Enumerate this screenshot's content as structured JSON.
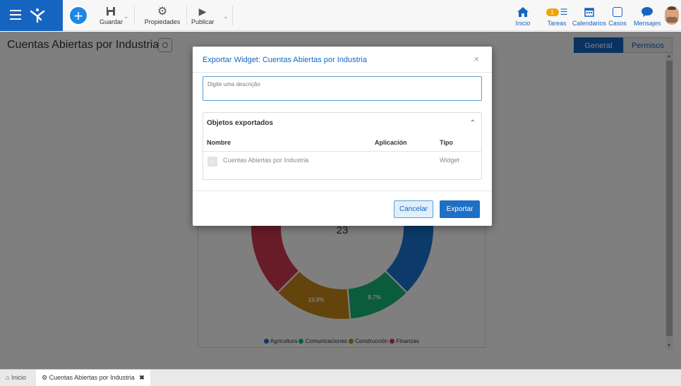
{
  "toolbar": {
    "save_label": "Guardar",
    "properties_label": "Propiedades",
    "publish_label": "Publicar"
  },
  "nav": {
    "home": "Inicio",
    "tasks": "Tareas",
    "tasks_badge": "1",
    "calendars": "Calendarios",
    "cases": "Casos",
    "messages": "Mensajes"
  },
  "page": {
    "title": "Cuentas Abiertas por Industria",
    "tab_general": "General",
    "tab_permissions": "Permisos"
  },
  "chart_data": {
    "type": "pie",
    "center_value": "23",
    "categories": [
      "Agricultura",
      "Comunicaciones",
      "Construcción",
      "Finanzas"
    ],
    "data_labels": [
      "",
      "8.7%",
      "13.0%",
      ""
    ],
    "colors": [
      "#1976d2",
      "#17b978",
      "#c8891a",
      "#d0384f"
    ]
  },
  "modal": {
    "title": "Exportar Widget: Cuentas Abiertas por Industria",
    "description_placeholder": "Digite uma descrição",
    "panel_title": "Objetos exportados",
    "col_name": "Nombre",
    "col_application": "Aplicación",
    "col_type": "Tipo",
    "row_name": "Cuentas Abiertas por Industria",
    "row_application": "",
    "row_type": "Widget",
    "cancel_label": "Cancelar",
    "export_label": "Exportar"
  },
  "bottom": {
    "home_tab": "Inicio",
    "active_tab": "Cuentas Abiertas por Industria"
  },
  "colors": {
    "brand": "#1565c0",
    "accent": "#1e88e5",
    "tasks_badge": "#f0a500"
  }
}
